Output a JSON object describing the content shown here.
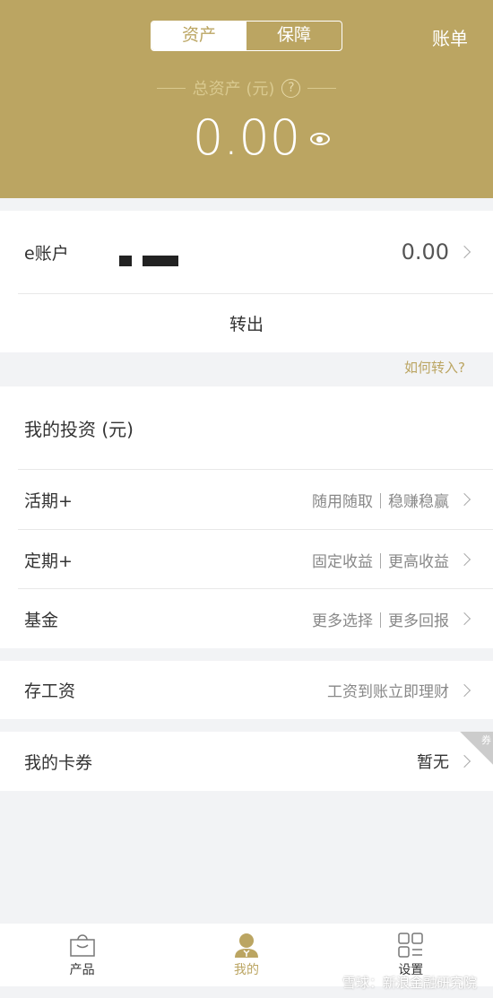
{
  "header": {
    "tabs": [
      {
        "label": "资产",
        "active": true
      },
      {
        "label": "保障",
        "active": false
      }
    ],
    "bill": "账单",
    "total_label": "总资产 (元)",
    "help": "?",
    "total": "0.00",
    "accent": "#bba562"
  },
  "account": {
    "label": "e账户",
    "value": "0.00",
    "transfer_out": "转出",
    "how_to": "如何转入?"
  },
  "invest": {
    "title": "我的投资 (元)",
    "items": [
      {
        "label": "活期+",
        "desc": "随用随取｜稳赚稳赢"
      },
      {
        "label": "定期+",
        "desc": "固定收益｜更高收益"
      },
      {
        "label": "基金",
        "desc": "更多选择｜更多回报"
      }
    ]
  },
  "salary": {
    "label": "存工资",
    "desc": "工资到账立即理财"
  },
  "coupons": {
    "label": "我的卡券",
    "value": "暂无",
    "corner": "券"
  },
  "tabbar": [
    {
      "label": "产品",
      "icon": "bag-icon"
    },
    {
      "label": "我的",
      "icon": "user-icon",
      "active": true
    },
    {
      "label": "设置",
      "icon": "grid-icon"
    }
  ],
  "watermark": "雪球：新浪金融研究院"
}
